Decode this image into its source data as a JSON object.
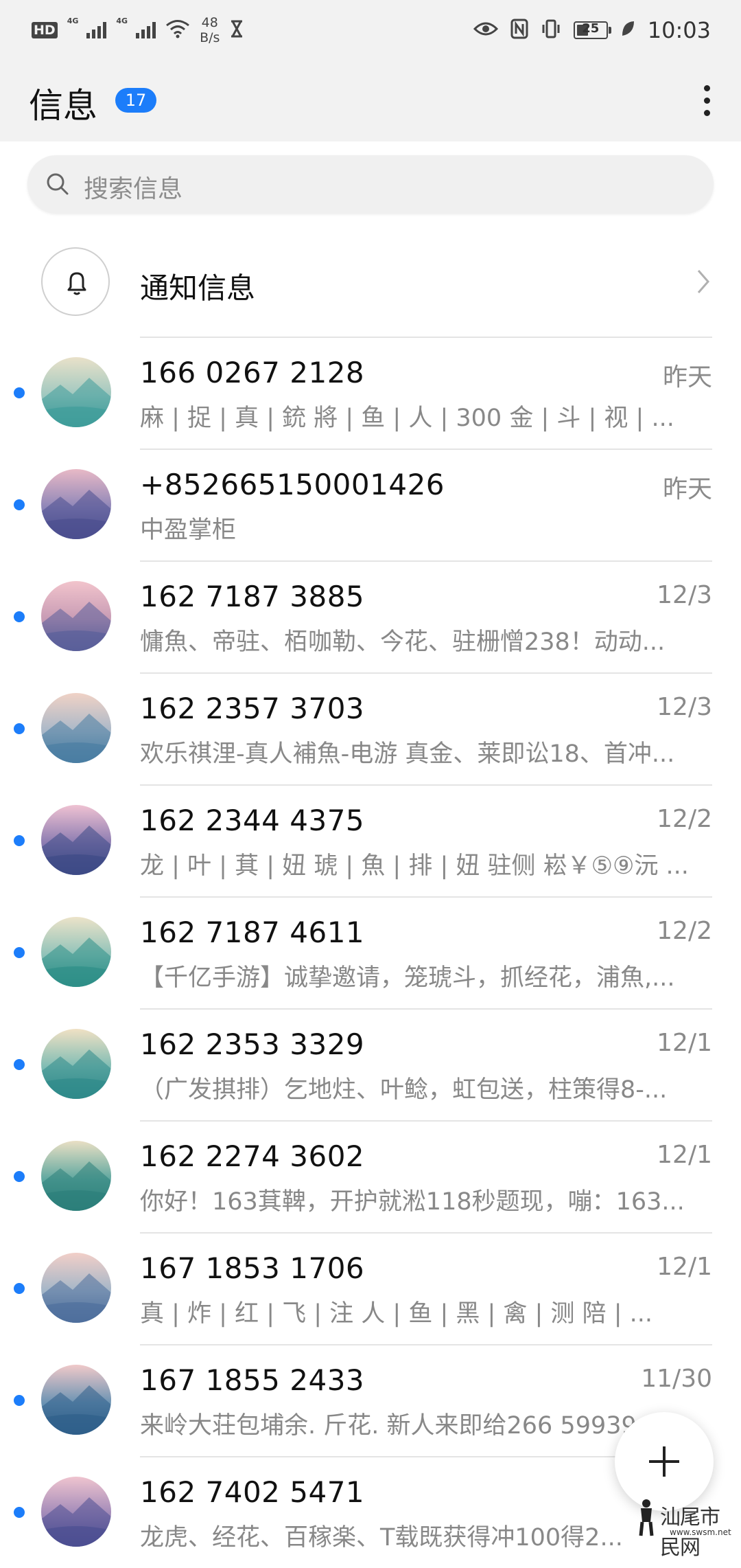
{
  "status_bar": {
    "hd": "HD",
    "sim1": "4G",
    "sim2": "4G",
    "speed_value": "48",
    "speed_unit": "B/s",
    "battery": "25",
    "time": "10:03"
  },
  "header": {
    "title": "信息",
    "unread_badge": "17"
  },
  "search": {
    "placeholder": "搜索信息"
  },
  "notification_row": {
    "label": "通知信息"
  },
  "conversations": [
    {
      "name": "166 0267 2128",
      "date": "昨天",
      "snippet": "麻 | 捉 | 真 | 銃 將 | 鱼 | 人 | 300 金 | 斗 | 视 | ...",
      "unread": true
    },
    {
      "name": "+852665150001426",
      "date": "昨天",
      "snippet": "中盈掌柜",
      "unread": true
    },
    {
      "name": "162 7187 3885",
      "date": "12/3",
      "snippet": "慵魚、帝驻、栢咖勒、今花、驻栅憎238！动动...",
      "unread": true
    },
    {
      "name": "162 2357 3703",
      "date": "12/3",
      "snippet": "欢乐祺浬-真人補魚-电游 真金、莱即讼18、首冲...",
      "unread": true
    },
    {
      "name": "162 2344 4375",
      "date": "12/2",
      "snippet": "龙 | 叶 | 萁 | 妞 琥 | 魚 | 排 | 妞 驻侧  崧￥⑤⑨沅 ...",
      "unread": true
    },
    {
      "name": "162 7187 4611",
      "date": "12/2",
      "snippet": "【千亿手游】诚挚邀请，笼琥斗，抓经花，浦魚,...",
      "unread": true
    },
    {
      "name": "162 2353 3329",
      "date": "12/1",
      "snippet": "（广发掑排）乞地炷、叶鲶，虹包送，柱策得8-...",
      "unread": true
    },
    {
      "name": "162 2274 3602",
      "date": "12/1",
      "snippet": "你好！163萁鞞，开护就淞118秒题现，嘣：163...",
      "unread": true
    },
    {
      "name": "167 1853 1706",
      "date": "12/1",
      "snippet": "真 | 炸 | 红 | 飞 | 注 人 | 鱼 | 黑 | 禽 | 测 陪 | ...",
      "unread": true
    },
    {
      "name": "167 1855 2433",
      "date": "11/30",
      "snippet": "来岭大荘包埔余. 斤花. 新人来即给266 59939...",
      "unread": true
    },
    {
      "name": "162 7402 5471",
      "date": "",
      "snippet": "龙虎、经花、百稼楽、T载既获得冲100得2...",
      "unread": true
    }
  ],
  "watermark": {
    "text": "汕尾市民网",
    "url": "www.swsm.net"
  },
  "colors": {
    "accent": "#1c7dfa",
    "header_bg": "#f2f2f2"
  }
}
